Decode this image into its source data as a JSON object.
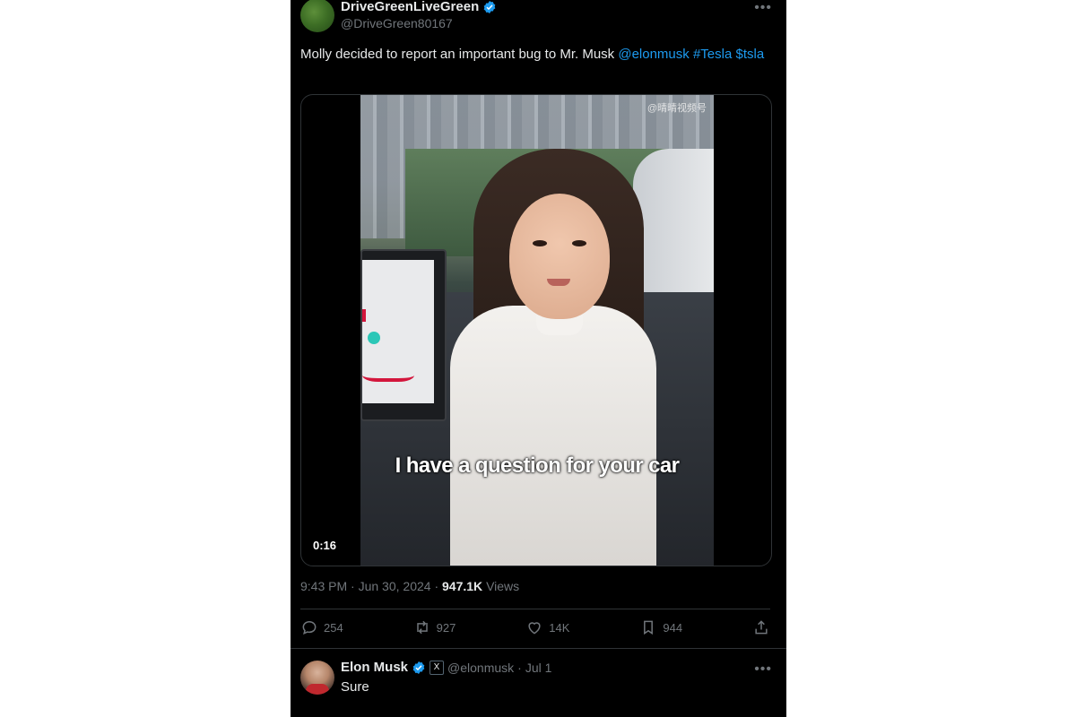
{
  "post": {
    "author_name": "DriveGreenLiveGreen",
    "author_handle": "@DriveGreen80167",
    "text_plain": "Molly decided to report an important bug to Mr. Musk",
    "mention": "@elonmusk",
    "hashtag": "#Tesla",
    "cashtag": "$tsla",
    "video": {
      "caption": "I have a question for your car",
      "duration": "0:16",
      "watermark": "@晴晴视频号"
    },
    "meta": {
      "time": "9:43 PM",
      "date": "Jun 30, 2024",
      "views_count": "947.1K",
      "views_label": "Views"
    },
    "actions": {
      "replies": "254",
      "reposts": "927",
      "likes": "14K",
      "bookmarks": "944"
    }
  },
  "reply": {
    "author_name": "Elon Musk",
    "badge": "X",
    "author_handle": "@elonmusk",
    "date": "Jul 1",
    "text": "Sure"
  },
  "colors": {
    "background": "#000000",
    "text": "#e7e9ea",
    "secondary": "#71767b",
    "link": "#1d9bf0",
    "verified": "#1d9bf0",
    "border": "#2f3336"
  },
  "icons": {
    "more": "more-icon",
    "verified": "verified-badge-icon",
    "reply": "reply-icon",
    "repost": "repost-icon",
    "like": "like-icon",
    "bookmark": "bookmark-icon",
    "share": "share-icon"
  }
}
